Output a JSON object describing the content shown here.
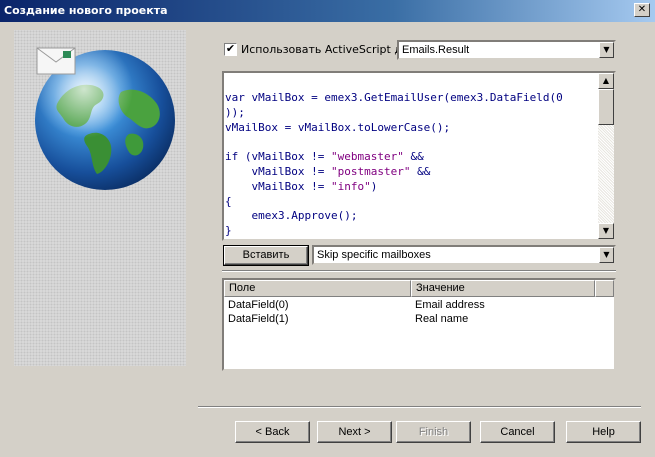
{
  "window": {
    "title": "Создание нового проекта",
    "close_glyph": "✕"
  },
  "activescript": {
    "checked": true,
    "check_glyph": "✔",
    "label": "Использовать ActiveScript для",
    "target_value": "Emails.Result"
  },
  "editor": {
    "lines": [
      {
        "segments": [
          {
            "t": "var vMailBox = emex3.GetEmailUser(emex3.DataField(0"
          }
        ]
      },
      {
        "segments": [
          {
            "t": "));"
          }
        ]
      },
      {
        "segments": [
          {
            "t": "vMailBox = vMailBox.toLowerCase();"
          }
        ]
      },
      {
        "segments": [
          {
            "t": ""
          }
        ]
      },
      {
        "segments": [
          {
            "t": "if (vMailBox != "
          },
          {
            "t": "\"webmaster\"",
            "s": 1
          },
          {
            "t": " &&"
          }
        ]
      },
      {
        "segments": [
          {
            "t": "    vMailBox != "
          },
          {
            "t": "\"postmaster\"",
            "s": 1
          },
          {
            "t": " &&"
          }
        ]
      },
      {
        "segments": [
          {
            "t": "    vMailBox != "
          },
          {
            "t": "\"info\"",
            "s": 1
          },
          {
            "t": ")"
          }
        ]
      },
      {
        "segments": [
          {
            "t": "{"
          }
        ]
      },
      {
        "segments": [
          {
            "t": "    emex3.Approve();"
          }
        ]
      },
      {
        "segments": [
          {
            "t": "}"
          }
        ]
      }
    ]
  },
  "insert": {
    "button_label": "Вставить",
    "template_value": "Skip specific mailboxes"
  },
  "fields_table": {
    "columns": [
      "Поле",
      "Значение"
    ],
    "rows": [
      [
        "DataField(0)",
        "Email address"
      ],
      [
        "DataField(1)",
        "Real name"
      ]
    ]
  },
  "footer": {
    "back_label": "< Back",
    "next_label": "Next >",
    "finish_label": "Finish",
    "cancel_label": "Cancel",
    "help_label": "Help"
  },
  "colors": {
    "titlebar_start": "#0a246a",
    "titlebar_end": "#a6caf0",
    "code_text": "#000080",
    "code_string": "#800080"
  },
  "icons": [
    "globe-icon",
    "envelope-icon",
    "close-icon",
    "chevron-down-icon",
    "scroll-up-icon",
    "scroll-down-icon"
  ]
}
